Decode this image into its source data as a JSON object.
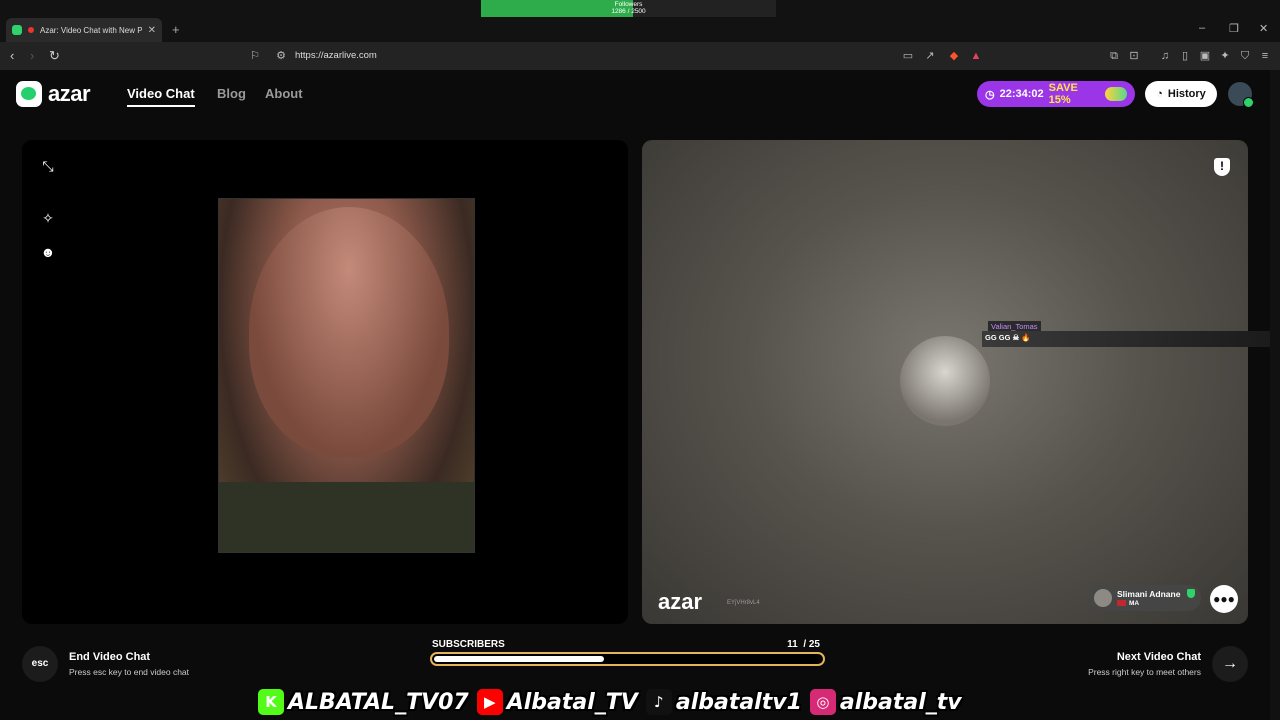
{
  "browser": {
    "tab_title": "Azar: Video Chat with New P",
    "url": "https://azarlive.com",
    "new_tab_symbol": "+"
  },
  "followers_overlay": {
    "label": "Followers",
    "count": "1286 / 2500",
    "progress": 0.5144
  },
  "site": {
    "logo_text": "azar",
    "nav": {
      "video_chat": "Video Chat",
      "blog": "Blog",
      "about": "About"
    },
    "promo": {
      "timer": "22:34:02",
      "save": "SAVE 15%"
    },
    "history_label": "History"
  },
  "right_panel": {
    "chat": {
      "username": "Valian_Tomas",
      "message": "GG GG ☠ 🔥"
    },
    "watermark": {
      "logo": "azar",
      "code": "EYjVHr8vL4"
    },
    "partner": {
      "name": "Slimani Adnane",
      "country": "MA"
    }
  },
  "bottom": {
    "esc_label": "esc",
    "end_title": "End Video Chat",
    "end_sub": "Press esc key to end video chat",
    "next_title": "Next Video Chat",
    "next_sub": "Press right key to meet others",
    "subscribers_label": "SUBSCRIBERS",
    "subscribers_count": "11",
    "subscribers_goal": "/ 25",
    "subscribers_progress": 0.44
  },
  "socials": [
    {
      "icon": "kick-icon",
      "handle": "ALBATAL_TV07",
      "color": "#53fc18",
      "glyph": "K"
    },
    {
      "icon": "youtube-icon",
      "handle": "Albatal_TV",
      "color": "#ff0000",
      "glyph": "▶"
    },
    {
      "icon": "tiktok-icon",
      "handle": "albataltv1",
      "color": "#111111",
      "glyph": "♪"
    },
    {
      "icon": "instagram-icon",
      "handle": "albatal_tv",
      "color": "#d62976",
      "glyph": "◎"
    }
  ],
  "colors": {
    "accent_green": "#24d06b",
    "promo_purple": "#9b35e8",
    "bar_gold": "#e6b35a"
  }
}
